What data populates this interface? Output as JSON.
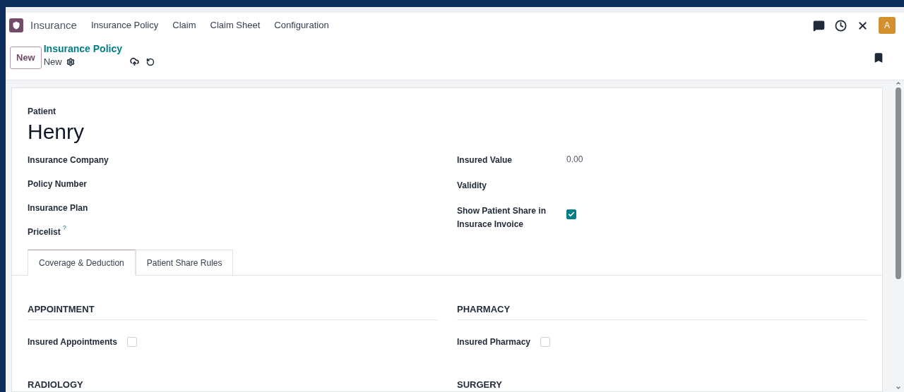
{
  "navbar": {
    "app_name": "Insurance",
    "menu": [
      "Insurance Policy",
      "Claim",
      "Claim Sheet",
      "Configuration"
    ],
    "avatar": "A"
  },
  "control_panel": {
    "new_button": "New",
    "breadcrumb": "Insurance Policy",
    "record": "New"
  },
  "form": {
    "patient_label": "Patient",
    "patient": "Henry",
    "left_fields": [
      {
        "label": "Insurance Company"
      },
      {
        "label": "Policy Number"
      },
      {
        "label": "Insurance Plan"
      },
      {
        "label": "Pricelist",
        "help": "?"
      }
    ],
    "right_fields": [
      {
        "kind": "text",
        "label": "Insured Value",
        "value": "0.00"
      },
      {
        "kind": "text",
        "label": "Validity"
      },
      {
        "kind": "checkbox",
        "label": "Show Patient Share in Insurace Invoice",
        "checked": true
      }
    ],
    "tabs": [
      {
        "label": "Coverage & Deduction",
        "selected": true
      },
      {
        "label": "Patient Share Rules",
        "selected": false
      }
    ],
    "sections": [
      {
        "title": "APPOINTMENT",
        "field": {
          "label": "Insured Appointments",
          "checked": false
        }
      },
      {
        "title": "PHARMACY",
        "field": {
          "label": "Insured Pharmacy",
          "checked": false
        }
      },
      {
        "title": "RADIOLOGY"
      },
      {
        "title": "SURGERY"
      }
    ]
  }
}
